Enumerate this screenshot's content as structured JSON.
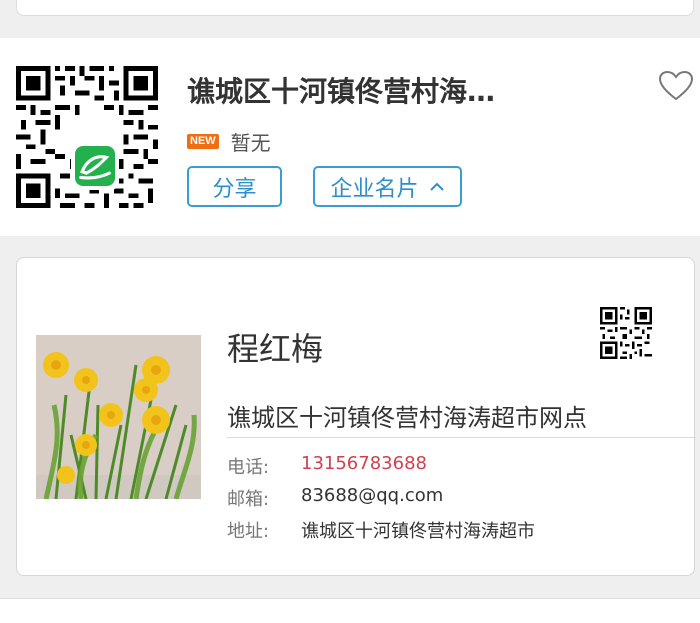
{
  "company": {
    "name": "谯城区十河镇佟营村海…",
    "badge": "NEW",
    "status": "暂无",
    "share_label": "分享",
    "card_label": "企业名片",
    "favorite_icon": "heart-outline-icon"
  },
  "business_card": {
    "person_name": "程红梅",
    "org_name": "谯城区十河镇佟营村海涛超市网点",
    "phone_label": "电话:",
    "phone_value": "13156783688",
    "email_label": "邮箱:",
    "email_value": "83688@qq.com",
    "address_label": "地址:",
    "address_value": "谯城区十河镇佟营村海涛超市"
  },
  "colors": {
    "accent": "#3a9cd4",
    "badge": "#f06d12",
    "phone": "#d0414e",
    "logo_green": "#22b14c"
  }
}
